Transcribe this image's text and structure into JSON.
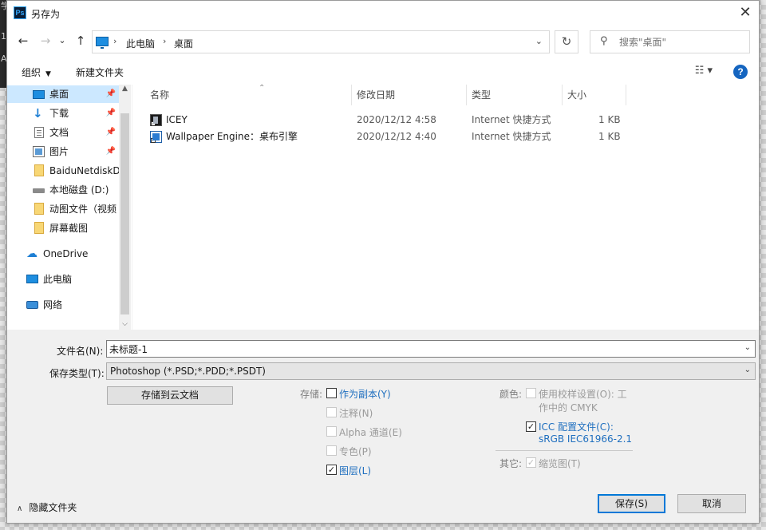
{
  "bg": {
    "chars": [
      "学",
      "1",
      "A"
    ]
  },
  "window": {
    "icon_text": "Ps",
    "title": "另存为",
    "close_symbol": "✕"
  },
  "nav": {
    "back_symbol": "←",
    "forward_symbol": "→",
    "recent_symbol": "⌄",
    "up_symbol": "↑",
    "breadcrumb": [
      "此电脑",
      "桌面"
    ],
    "separator": "›",
    "dropdown_symbol": "⌄",
    "refresh_symbol": "↻",
    "search_icon_symbol": "⚲",
    "search_placeholder": "搜索\"桌面\""
  },
  "toolbar": {
    "organize_label": "组织",
    "organize_caret": "▼",
    "new_folder_label": "新建文件夹",
    "view_symbol": "☷ ▾",
    "help_symbol": "?"
  },
  "sidebar": {
    "items": [
      {
        "label": "桌面",
        "icon": "desktop-icon",
        "pinned": true,
        "selected": true
      },
      {
        "label": "下载",
        "icon": "download-icon",
        "pinned": true
      },
      {
        "label": "文档",
        "icon": "document-icon",
        "pinned": true
      },
      {
        "label": "图片",
        "icon": "pictures-icon",
        "pinned": true
      },
      {
        "label": "BaiduNetdiskD",
        "icon": "folder-icon"
      },
      {
        "label": "本地磁盘 (D:)",
        "icon": "drive-icon"
      },
      {
        "label": "动图文件（视频",
        "icon": "folder-icon"
      },
      {
        "label": "屏幕截图",
        "icon": "folder-icon"
      },
      {
        "label": "OneDrive",
        "icon": "onedrive-icon"
      },
      {
        "label": "此电脑",
        "icon": "this-pc-icon"
      },
      {
        "label": "网络",
        "icon": "network-icon"
      }
    ],
    "pin_symbol": "📌",
    "scroll_up_symbol": "▲",
    "scroll_down_symbol": "⌵"
  },
  "files": {
    "sort_caret": "⌃",
    "columns": [
      "名称",
      "修改日期",
      "类型",
      "大小"
    ],
    "rows": [
      {
        "name": "ICEY",
        "date": "2020/12/12 4:58",
        "type": "Internet 快捷方式",
        "size": "1 KB",
        "icon": "icey-shortcut-icon"
      },
      {
        "name": "Wallpaper Engine：桌布引擎",
        "date": "2020/12/12 4:40",
        "type": "Internet 快捷方式",
        "size": "1 KB",
        "icon": "wallpaper-engine-shortcut-icon"
      }
    ]
  },
  "save": {
    "filename_label": "文件名(N):",
    "filename_value": "未标题-1",
    "filetype_label": "保存类型(T):",
    "filetype_value": "Photoshop (*.PSD;*.PDD;*.PSDT)",
    "dropdown_symbol": "⌄",
    "cloud_button": "存储到云文档",
    "storage_label": "存储:",
    "storage_options": [
      {
        "label": "作为副本(Y)",
        "checked": false,
        "enabled": true
      },
      {
        "label": "注释(N)",
        "checked": false,
        "enabled": false
      },
      {
        "label": "Alpha 通道(E)",
        "checked": false,
        "enabled": false
      },
      {
        "label": "专色(P)",
        "checked": false,
        "enabled": false
      },
      {
        "label": "图层(L)",
        "checked": true,
        "enabled": true
      }
    ],
    "color_label": "颜色:",
    "proof_label_line1": "使用校样设置(O):  工",
    "proof_label_line2": "作中的 CMYK",
    "icc_label_line1": "ICC 配置文件(C):",
    "icc_label_line2": "sRGB IEC61966-2.1",
    "other_label": "其它:",
    "thumbnail_label": "缩览图(T)",
    "check_symbol": "✓",
    "hide_folders_label": "隐藏文件夹",
    "hide_folders_caret": "∧",
    "save_button": "保存(S)",
    "cancel_button": "取消"
  }
}
